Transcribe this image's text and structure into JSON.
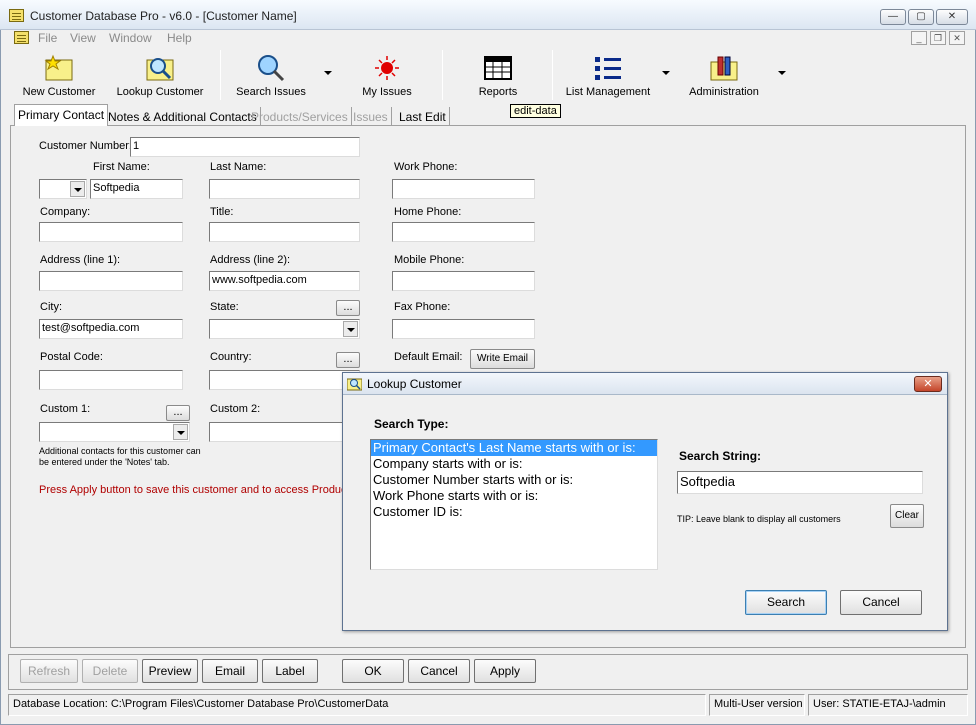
{
  "window": {
    "title": "Customer Database Pro - v6.0 - [Customer Name]"
  },
  "caption_buttons": {
    "minimize": "—",
    "maximize": "▢",
    "close": "✕"
  },
  "mdi_buttons": {
    "minimize": "_",
    "restore": "❐",
    "close": "✕"
  },
  "menu": [
    "File",
    "View",
    "Window",
    "Help"
  ],
  "toolbar": {
    "new_customer": "New Customer",
    "lookup_customer": "Lookup Customer",
    "search_issues": "Search Issues",
    "my_issues": "My Issues",
    "reports": "Reports",
    "list_management": "List Management",
    "administration": "Administration",
    "tooltip": "edit-data"
  },
  "tabs": [
    {
      "label": "Primary Contact",
      "state": "active"
    },
    {
      "label": "Notes & Additional Contacts",
      "state": "normal"
    },
    {
      "label": "Products/Services",
      "state": "disabled"
    },
    {
      "label": "Issues",
      "state": "disabled"
    },
    {
      "label": "Last Edit",
      "state": "normal"
    }
  ],
  "form": {
    "customer_number_label": "Customer Number:",
    "customer_number": "1",
    "first_name_label": "First Name:",
    "first_name": "Softpedia",
    "last_name_label": "Last Name:",
    "last_name": "",
    "work_phone_label": "Work Phone:",
    "company_label": "Company:",
    "title_label": "Title:",
    "home_phone_label": "Home Phone:",
    "address1_label": "Address (line 1):",
    "address2_label": "Address (line 2):",
    "address2": "www.softpedia.com",
    "mobile_phone_label": "Mobile Phone:",
    "city_label": "City:",
    "city": "test@softpedia.com",
    "state_label": "State:",
    "fax_phone_label": "Fax Phone:",
    "postal_code_label": "Postal Code:",
    "country_label": "Country:",
    "default_email_label": "Default Email:",
    "write_email": "Write Email",
    "custom1_label": "Custom 1:",
    "custom2_label": "Custom 2:",
    "ellipsis": "...",
    "contacts_note": "Additional contacts for this customer can be entered under the 'Notes' tab.",
    "apply_note": "Press Apply button to save this customer and to access Product"
  },
  "bottom_buttons": {
    "refresh": "Refresh",
    "delete": "Delete",
    "preview": "Preview",
    "email": "Email",
    "label": "Label",
    "ok": "OK",
    "cancel": "Cancel",
    "apply": "Apply"
  },
  "status": {
    "db_location": "Database Location: C:\\Program Files\\Customer Database Pro\\CustomerData",
    "version": "Multi-User version",
    "user": "User: STATIE-ETAJ-\\admin"
  },
  "dialog": {
    "title": "Lookup Customer",
    "search_type_label": "Search Type:",
    "search_types": [
      "Primary Contact's Last Name starts with or is:",
      "Company starts with or is:",
      "Customer Number starts with or is:",
      "Work Phone starts with or is:",
      "Customer ID is:"
    ],
    "selected_index": 0,
    "search_string_label": "Search String:",
    "search_string": "Softpedia",
    "tip": "TIP: Leave blank to display all customers",
    "clear": "Clear",
    "search": "Search",
    "cancel": "Cancel"
  },
  "colors": {
    "accent": "#3399ff",
    "note_red": "#b00000",
    "tooltip_bg": "#ffffe1"
  }
}
